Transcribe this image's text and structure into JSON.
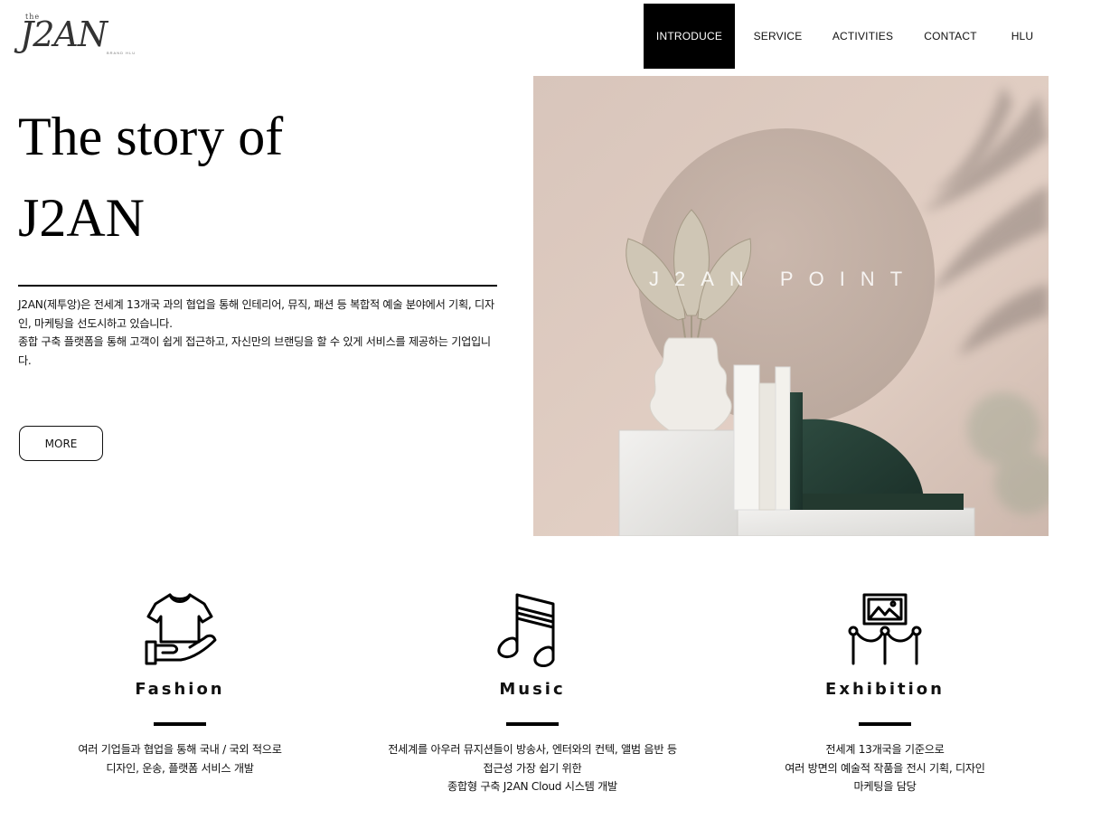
{
  "header": {
    "logo_the": "the",
    "logo_mark": "J2AN",
    "logo_tag": "BRAND HLU",
    "nav": [
      {
        "label": "INTRODUCE",
        "active": true
      },
      {
        "label": "SERVICE",
        "active": false
      },
      {
        "label": "ACTIVITIES",
        "active": false
      },
      {
        "label": "CONTACT",
        "active": false
      },
      {
        "label": "HLU",
        "active": false
      }
    ]
  },
  "hero": {
    "title_line1": "The story of",
    "title_line2": "J2AN",
    "desc_line1": "J2AN(제투앙)은 전세계 13개국 과의 협업을 통해 인테리어, 뮤직, 패션 등 복합적 예술 분야에서 기획, 디자인, 마케팅을 선도시하고 있습니다.",
    "desc_line2": "종합 구축 플랫폼을 통해 고객이 쉽게 접근하고, 자신만의 브랜딩을 할 수 있게 서비스를 제공하는 기업입니다.",
    "more_label": "MORE",
    "image_text": "J2AN POINT"
  },
  "categories": [
    {
      "icon": "tshirt-hand-icon",
      "title": "Fashion",
      "desc": [
        "여러 기업들과 협업을 통해 국내 / 국외 적으로",
        "디자인, 운송, 플랫폼 서비스 개발"
      ]
    },
    {
      "icon": "music-note-icon",
      "title": "Music",
      "desc": [
        "전세계를 아우러 뮤지션들이 방송사, 엔터와의 컨텍, 앨범 음반 등",
        "접근성 가장 쉽기 위한",
        "종합형 구축 J2AN Cloud 시스템 개발"
      ]
    },
    {
      "icon": "exhibition-frame-icon",
      "title": "Exhibition",
      "desc": [
        "전세계 13개국을 기준으로",
        "여러 방면의 예술적 작품을 전시 기획, 디자인",
        "마케팅을 담당"
      ]
    }
  ],
  "colors": {
    "accent": "#000000",
    "image_wall": "#d9c4b8"
  }
}
